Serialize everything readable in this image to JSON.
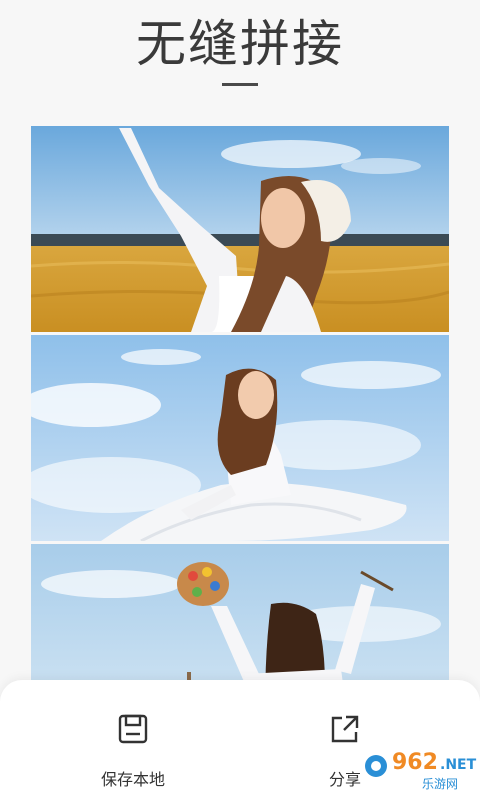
{
  "header": {
    "title": "无缝拼接"
  },
  "collage": {
    "photos": [
      {
        "name": "woman-in-wheat-field"
      },
      {
        "name": "woman-with-white-dress-sky"
      },
      {
        "name": "woman-with-paint-palette"
      }
    ]
  },
  "actions": {
    "save_label": "保存本地",
    "share_label": "分享"
  },
  "watermark": {
    "text_top": "962.NET",
    "text_bottom": "乐游网"
  },
  "colors": {
    "background": "#f7f7f7",
    "sheet": "#ffffff",
    "watermark_blue": "#2a8fd6",
    "watermark_orange": "#f08a24"
  }
}
